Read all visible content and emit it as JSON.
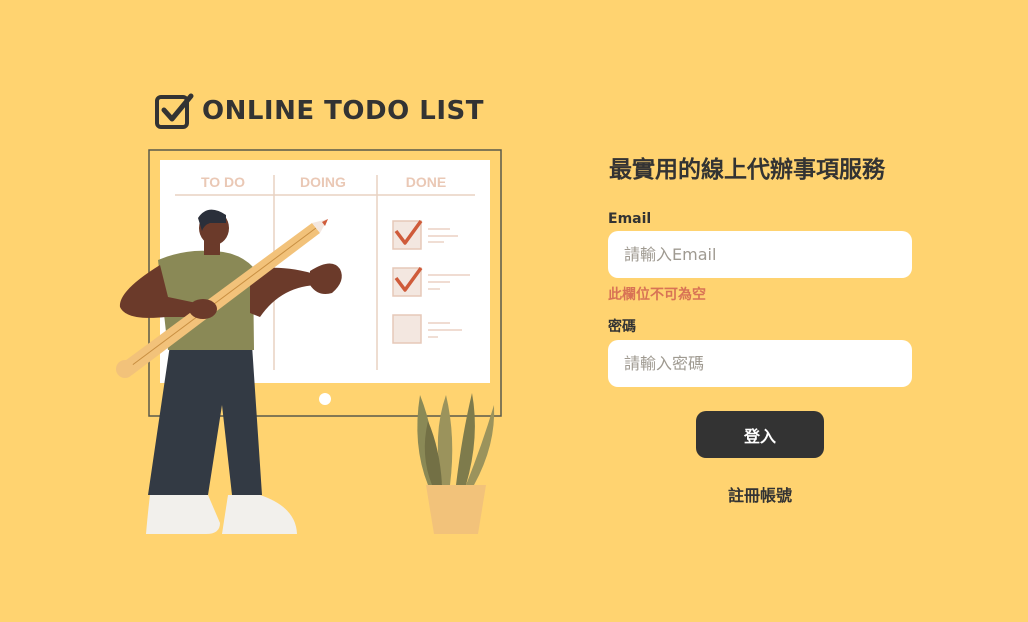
{
  "app": {
    "logo_text": "ONLINE TODO LIST",
    "logo_icon": "checkbox-check-icon"
  },
  "illustration": {
    "board_columns": [
      "TO DO",
      "DOING",
      "DONE"
    ]
  },
  "login": {
    "title": "最實用的線上代辦事項服務",
    "email_label": "Email",
    "email_placeholder": "請輸入Email",
    "email_value": "",
    "email_error": "此欄位不可為空",
    "password_label": "密碼",
    "password_placeholder": "請輸入密碼",
    "password_value": "",
    "submit_label": "登入",
    "register_label": "註冊帳號"
  },
  "colors": {
    "background": "#FFD370",
    "primary_dark": "#333333",
    "error": "#D87355",
    "input_bg": "#FFFFFF"
  }
}
